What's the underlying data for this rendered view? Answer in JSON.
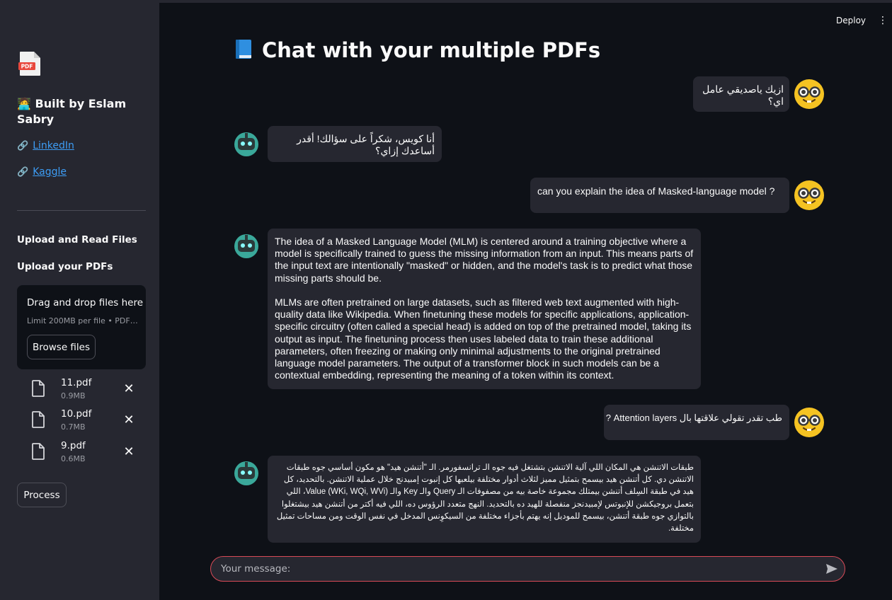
{
  "sidebar": {
    "built_by": "🧑‍💻 Built by Eslam Sabry",
    "links": [
      {
        "label": "LinkedIn",
        "icon": "link-icon"
      },
      {
        "label": "Kaggle",
        "icon": "link-icon"
      }
    ],
    "upload_heading": "Upload and Read Files",
    "upload_label": "Upload your PDFs",
    "dropzone": {
      "title": "Drag and drop files here",
      "subtitle": "Limit 200MB per file • PDF, …",
      "browse_label": "Browse files"
    },
    "files": [
      {
        "name": "11.pdf",
        "size": "0.9MB"
      },
      {
        "name": "10.pdf",
        "size": "0.7MB"
      },
      {
        "name": "9.pdf",
        "size": "0.6MB"
      }
    ],
    "process_label": "Process"
  },
  "header": {
    "deploy_label": "Deploy",
    "menu_icon": "kebab-menu-icon"
  },
  "main": {
    "title": "Chat with your multiple PDFs",
    "title_icon": "blue-book-icon"
  },
  "messages": [
    {
      "role": "user",
      "text": "ازيك ياصديقي عامل اي؟"
    },
    {
      "role": "assistant",
      "text": "أنا كويس، شكراً على سؤالك! أقدر أساعدك إزاي؟"
    },
    {
      "role": "user",
      "text": "can you explain the idea of Masked-language model ?"
    },
    {
      "role": "assistant",
      "paragraphs": [
        "The idea of a Masked Language Model (MLM) is centered around a training objective where a model is specifically trained to guess the missing information from an input. This means parts of the input text are intentionally \"masked\" or hidden, and the model's task is to predict what those missing parts should be.",
        "MLMs are often pretrained on large datasets, such as filtered web text augmented with high-quality data like Wikipedia. When finetuning these models for specific applications, application-specific circuitry (often called a special head) is added on top of the pretrained model, taking its output as input. The finetuning process then uses labeled data to train these additional parameters, often freezing or making only minimal adjustments to the original pretrained language model parameters. The output of a transformer block in such models can be a contextual embedding, representing the meaning of a token within its context."
      ]
    },
    {
      "role": "user",
      "text": "طب تقدر تقولي علاقتها بال Attention layers ?"
    },
    {
      "role": "assistant",
      "text": "طبقات الاتنشن هي المكان اللي آلية الاتنشن بتشتغل فيه جوه الـ ترانسفورمر. الـ \"أتنشن هيد\" هو مكون أساسي جوه طبقات الاتنشن دي. كل أتنشن هيد بيسمح بتمثيل مميز لثلاث أدوار مختلفة بيلعبها كل إنبوت إمبيدنج خلال عملية الاتنشن. بالتحديد، كل هيد في طبقة السِلف أتنشن بيمتلك مجموعة خاصة بيه من مصفوفات الـ Query والـ Key والـ Value (WKi, WQi, WVi)، اللي بتعمل بروجيكشن للإنبوتس لإمبيدنجز منفصلة للهيد ده بالتحديد. النهج متعدد الرؤوس ده، اللي فيه أكتر من أتنشن هيد بيشتغلوا بالتوازي جوه طبقة أتنشن، بيسمح للموديل إنه يهتم بأجزاء مختلفة من السيكوِنس المدخل في نفس الوقت ومن مساحات تمثيل مختلفة."
    }
  ],
  "chat_input": {
    "placeholder": "Your message:",
    "send_icon": "send-icon"
  },
  "colors": {
    "background": "#0e1117",
    "sidebar": "#262730",
    "bubble": "#262730",
    "input_border": "#d84a57",
    "link": "#3d9df5"
  }
}
